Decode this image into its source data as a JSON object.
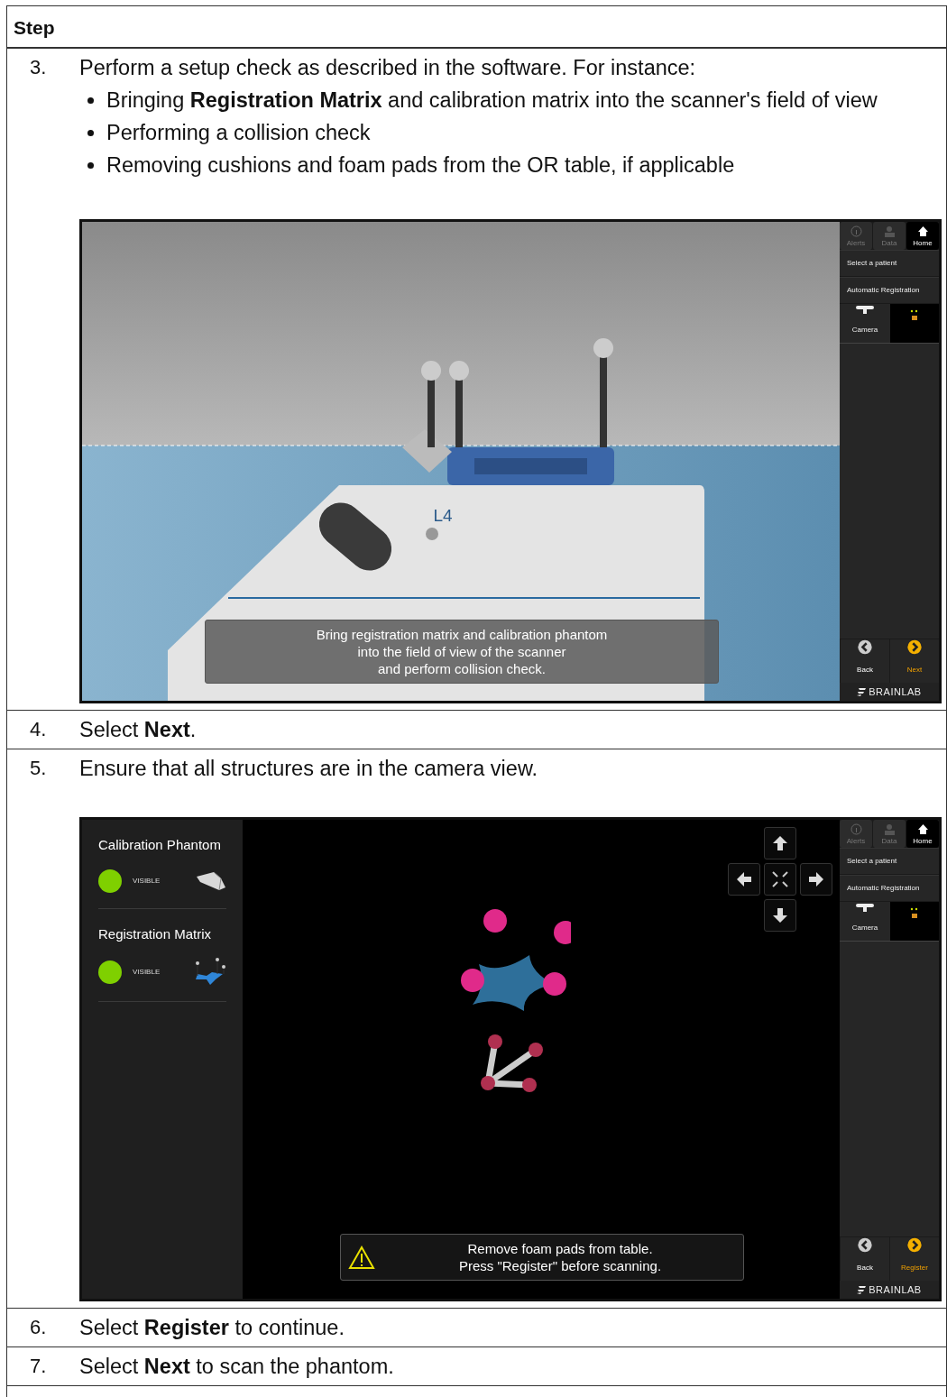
{
  "table": {
    "header": "Step",
    "rows": [
      {
        "number": "3.",
        "text": "Perform a setup check as described in the software. For instance:",
        "bullets": [
          "Bringing **Registration Matrix** and calibration matrix into the scanner's field of view",
          "Performing a collision check",
          "Removing cushions and foam pads from the OR table, if applicable"
        ],
        "screenshot": {
          "kind": "scanner",
          "scene_label": "L4",
          "message": [
            "Bring registration matrix and calibration phantom",
            "into the field of view of the scanner",
            "and perform collision check."
          ],
          "sidebar": {
            "tabs": [
              {
                "label": "Alerts",
                "selected": false
              },
              {
                "label": "Data",
                "selected": false
              },
              {
                "label": "Home",
                "selected": true
              }
            ],
            "menu": [
              "Select a patient",
              "Automatic Registration"
            ],
            "camera": "Camera",
            "back": "Back",
            "next": "Next",
            "logo": "BRAINLAB"
          }
        }
      },
      {
        "number": "4.",
        "text": "Select **Next**."
      },
      {
        "number": "5.",
        "text": "Ensure that all structures are in the camera view.",
        "screenshot": {
          "kind": "camera",
          "structures": [
            {
              "name": "Calibration Phantom",
              "status": "VISIBLE",
              "visible": true,
              "kind": "phantom"
            },
            {
              "name": "Registration Matrix",
              "status": "VISIBLE",
              "visible": true,
              "kind": "matrix"
            }
          ],
          "message": [
            "Remove foam pads from table.",
            "Press \"Register\" before scanning."
          ],
          "sidebar": {
            "tabs": [
              {
                "label": "Alerts",
                "selected": false
              },
              {
                "label": "Data",
                "selected": false
              },
              {
                "label": "Home",
                "selected": true
              }
            ],
            "menu": [
              "Select a patient",
              "Automatic Registration"
            ],
            "camera": "Camera",
            "back": "Back",
            "next": "Register",
            "logo": "BRAINLAB"
          }
        }
      },
      {
        "number": "6.",
        "text": "Select **Register** to continue."
      },
      {
        "number": "7.",
        "text": "Select **Next** to scan the phantom."
      }
    ]
  }
}
